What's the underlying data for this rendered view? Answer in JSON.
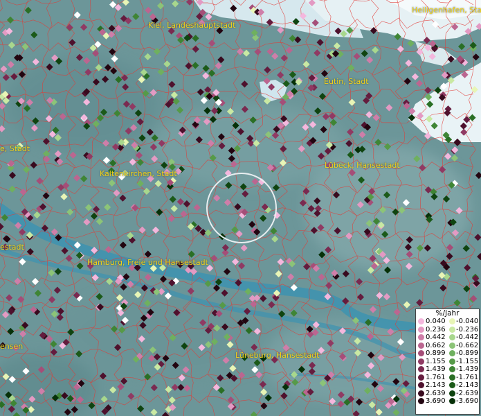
{
  "map": {
    "cities": [
      {
        "name": "Kiel, Landeshauptstadt"
      },
      {
        "name": "Heiligenhafen, Stadt"
      },
      {
        "name": "Eutin, Stadt"
      },
      {
        "name": "...e, Stadt",
        "display": "e, Stadt"
      },
      {
        "name": "Kaltenkirchen, Stadt"
      },
      {
        "name": "Lübeck, Hansestadt"
      },
      {
        "name": "...estadt",
        "display": "estadt"
      },
      {
        "name": "Hamburg, Freie und Hansestadt"
      },
      {
        "name": "...ensen",
        "display": "ensen"
      },
      {
        "name": "Lüneburg, Hansestadt"
      }
    ]
  },
  "legend": {
    "unit": "%/Jahr",
    "rows": [
      {
        "pos": "0.040",
        "neg": "-0.040",
        "pos_color": "#f4b7dd",
        "neg_color": "#e8f5b6"
      },
      {
        "pos": "0.236",
        "neg": "-0.236",
        "pos_color": "#e39ac3",
        "neg_color": "#c9e9a3"
      },
      {
        "pos": "0.442",
        "neg": "-0.442",
        "pos_color": "#cf7ea9",
        "neg_color": "#a8d78d"
      },
      {
        "pos": "0.662",
        "neg": "-0.662",
        "pos_color": "#bb6690",
        "neg_color": "#8cc478"
      },
      {
        "pos": "0.899",
        "neg": "-0.899",
        "pos_color": "#a54e78",
        "neg_color": "#6fb05f"
      },
      {
        "pos": "1.155",
        "neg": "-1.155",
        "pos_color": "#903a63",
        "neg_color": "#569a48"
      },
      {
        "pos": "1.439",
        "neg": "-1.439",
        "pos_color": "#7a2a50",
        "neg_color": "#3f8535"
      },
      {
        "pos": "1.761",
        "neg": "-1.761",
        "pos_color": "#641c3e",
        "neg_color": "#2a6f25"
      },
      {
        "pos": "2.143",
        "neg": "-2.143",
        "pos_color": "#4e112d",
        "neg_color": "#1b5a19"
      },
      {
        "pos": "2.639",
        "neg": "-2.639",
        "pos_color": "#380a1e",
        "neg_color": "#0f4410"
      },
      {
        "pos": "3.690",
        "neg": "-3.690",
        "pos_color": "#220510",
        "neg_color": "#063008"
      }
    ]
  }
}
